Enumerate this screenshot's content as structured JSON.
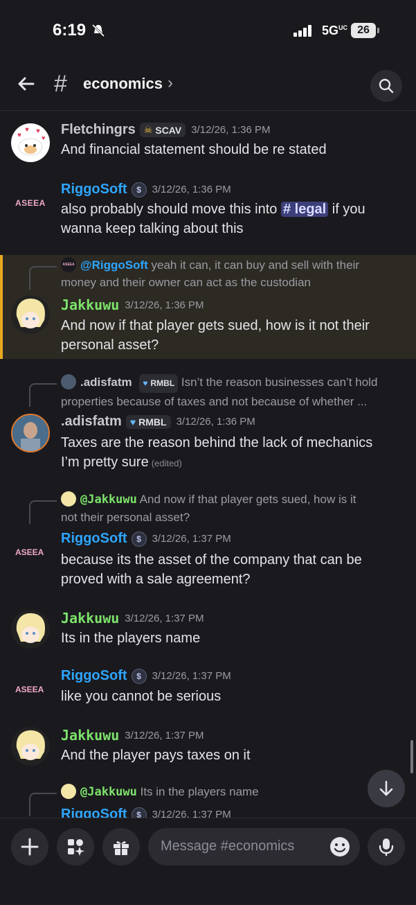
{
  "status": {
    "time": "6:19",
    "network": "5G",
    "network_sup": "UC",
    "battery": "26"
  },
  "header": {
    "channel": "economics"
  },
  "messages": [
    {
      "name": "Fletchingrs",
      "badge": "SCAV",
      "time": "3/12/26, 1:36 PM",
      "lines": [
        "And financial statement should be re stated"
      ]
    },
    {
      "name": "RiggoSoft",
      "time": "3/12/26, 1:36 PM",
      "line1a": "also probably should move this into ",
      "mention": "# legal",
      "line1b": " if you",
      "line2": "wanna keep talking about this",
      "avatar_text": "ASEEA"
    },
    {
      "reply_name": "@RiggoSoft",
      "reply_text1": " yeah it can, it can buy and sell with their",
      "reply_text2": "money and their owner can act as the custodian",
      "name": "Jakkuwu",
      "time": "3/12/26, 1:36 PM",
      "lines": [
        "And now if that player gets sued, how is it not their",
        "personal asset?"
      ]
    },
    {
      "reply_name": ".adisfatm",
      "reply_badge": "RMBL",
      "reply_text1": " Isn’t the reason businesses can’t hold",
      "reply_text2": "properties because of taxes and not because of whether ...",
      "name": ".adisfatm",
      "badge": "RMBL",
      "time": "3/12/26, 1:36 PM",
      "lines": [
        "Taxes are the reason behind the lack of mechanics",
        "I’m pretty sure"
      ],
      "edited": "(edited)"
    },
    {
      "reply_name": "@Jakkuwu",
      "reply_text1": " And now if that player gets sued, how is it",
      "reply_text2": "not their personal asset?",
      "name": "RiggoSoft",
      "time": "3/12/26, 1:37 PM",
      "lines": [
        "because its the asset of the company that can be",
        "proved with a sale agreement?"
      ]
    },
    {
      "name": "Jakkuwu",
      "time": "3/12/26, 1:37 PM",
      "lines": [
        "Its in the players name"
      ]
    },
    {
      "name": "RiggoSoft",
      "time": "3/12/26, 1:37 PM",
      "lines": [
        "like you cannot be serious"
      ]
    },
    {
      "name": "Jakkuwu",
      "time": "3/12/26, 1:37 PM",
      "lines": [
        "And the player pays taxes on it"
      ]
    },
    {
      "reply_name": "@Jakkuwu",
      "reply_text1": " Its in the players name",
      "name": "RiggoSoft",
      "time": "3/12/26, 1:37 PM"
    }
  ],
  "composer": {
    "placeholder": "Message #economics"
  },
  "icons": [
    "silent-bell-icon",
    "signal-icon",
    "back-arrow-icon",
    "hash-icon",
    "search-icon",
    "dollar-coin-icon",
    "skull-icon",
    "heart-shield-icon",
    "arrow-down-icon",
    "plus-icon",
    "apps-icon",
    "gift-icon",
    "emoji-icon",
    "microphone-icon"
  ],
  "colors": {
    "background": "#1a1a1e",
    "riggo": "#2ea6ff",
    "jakk": "#7de36b",
    "highlight_border": "#e6a91e",
    "mention_bg": "#3d3f7a"
  }
}
